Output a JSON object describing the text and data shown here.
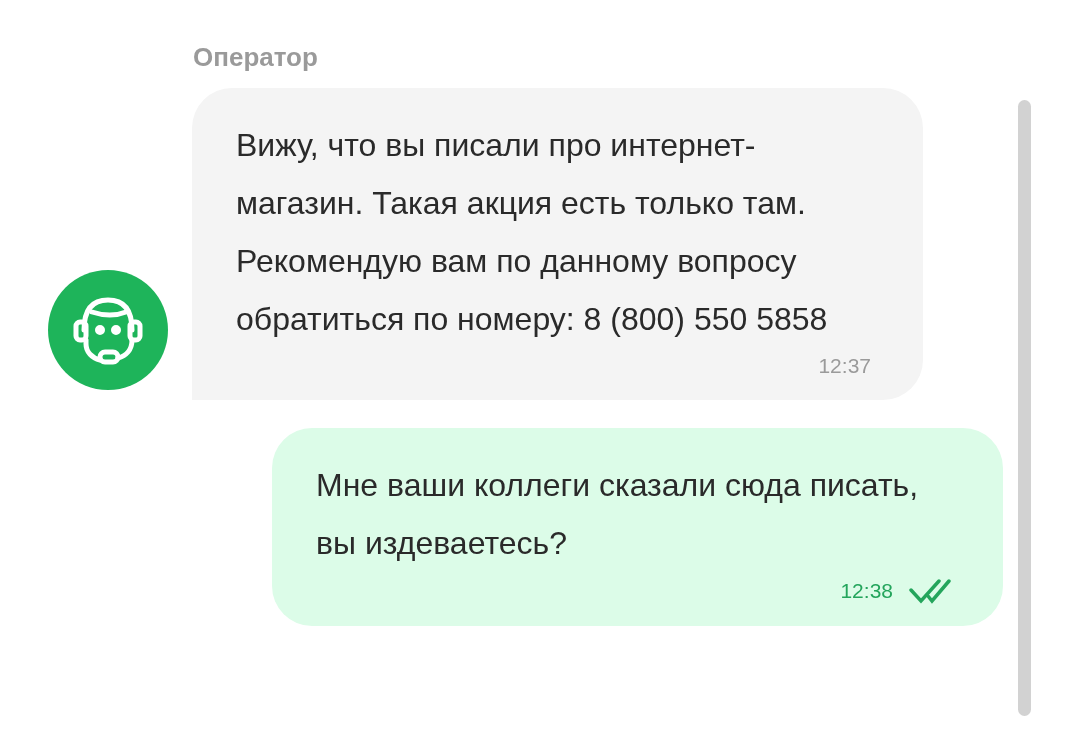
{
  "sender": "Оператор",
  "messages": [
    {
      "kind": "incoming",
      "text": "Вижу, что вы писали про интернет-магазин. Такая акция есть только там. Рекомендую вам по данному вопросу обратиться по номеру: 8 (800) 550 5858",
      "time": "12:37"
    },
    {
      "kind": "outgoing",
      "text": "Мне ваши коллеги сказали сюда писать, вы издеваетесь?",
      "time": "12:38",
      "read": true
    }
  ]
}
